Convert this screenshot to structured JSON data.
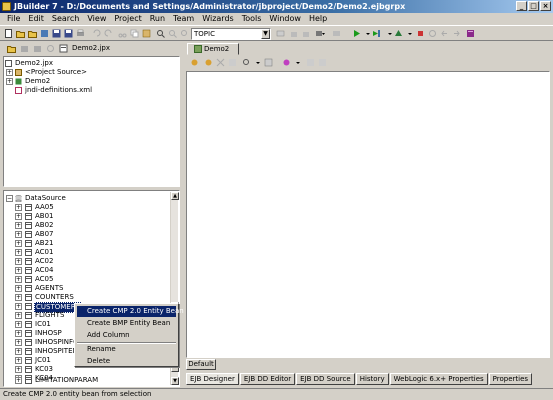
{
  "window": {
    "title": "JBuilder 7 - D:/Documents and Settings/Administrator/jbproject/Demo2/Demo2.ejbgrpx"
  },
  "menu": [
    "File",
    "Edit",
    "Search",
    "View",
    "Project",
    "Run",
    "Team",
    "Wizards",
    "Tools",
    "Window",
    "Help"
  ],
  "toolbar": {
    "topic_value": "TOPIC"
  },
  "project": {
    "file_tab": "Demo2.jpx",
    "tree": [
      {
        "label": "Demo2.jpx",
        "level": 0
      },
      {
        "label": "<Project Source>",
        "level": 1
      },
      {
        "label": "Demo2",
        "level": 1
      },
      {
        "label": "jndi-definitions.xml",
        "level": 1
      }
    ]
  },
  "datasource": {
    "root": "DataSource",
    "tables": [
      "AA05",
      "AB01",
      "AB02",
      "AB07",
      "AB21",
      "AC01",
      "AC02",
      "AC04",
      "AC05",
      "AGENTS",
      "COUNTERS",
      "CUSTOMERS",
      "FLIGHTS",
      "IC01",
      "INHOSP",
      "INHOSPINFO",
      "INHOSPITEM",
      "JC01",
      "KC03",
      "KC04",
      "LIMITATIONPARAM"
    ],
    "selected": "CUSTOMERS"
  },
  "context_menu": {
    "items": [
      "Create CMP 2.0 Entity Bean",
      "Create BMP Entity Bean",
      "Add Column",
      "Rename",
      "Delete"
    ]
  },
  "editor": {
    "tab": "Demo2",
    "default_tab": "Default",
    "bottom_tabs": [
      "EJB Designer",
      "EJB DD Editor",
      "EJB DD Source",
      "History",
      "WebLogic 6.x+ Properties",
      "Properties"
    ]
  },
  "status": {
    "text": "Create CMP 2.0 entity bean from selection"
  }
}
